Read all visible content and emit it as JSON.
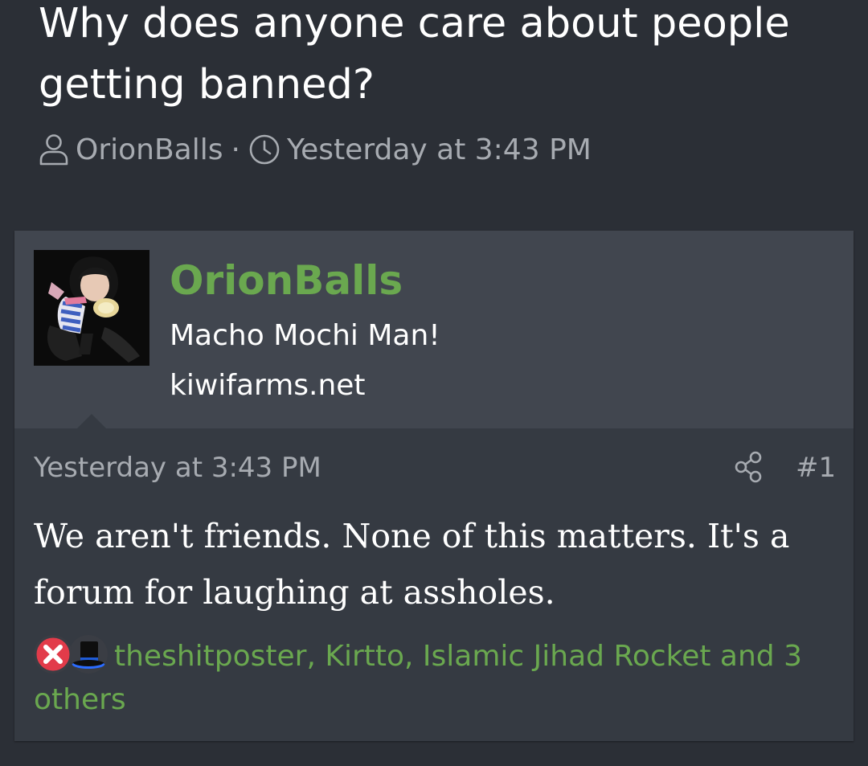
{
  "thread": {
    "title": "Why does anyone care about people getting banned?",
    "author": "OrionBalls",
    "separator": "·",
    "time": "Yesterday at 3:43 PM"
  },
  "post": {
    "username": "OrionBalls",
    "user_title": "Macho Mochi Man!",
    "site": "kiwifarms.net",
    "date": "Yesterday at 3:43 PM",
    "number": "#1",
    "body": "We aren't friends. None of this matters. It's a forum for laughing at assholes.",
    "reactions": {
      "icons": [
        "x-reaction-icon",
        "top-hat-reaction-icon"
      ],
      "text": "theshitposter, Kirtto, Islamic Jihad Rocket and 3 others"
    }
  },
  "colors": {
    "background": "#2b2f36",
    "post_header": "#41464f",
    "post_body": "#353a42",
    "username": "#6aa84f",
    "meta_text": "#a7abb1"
  }
}
